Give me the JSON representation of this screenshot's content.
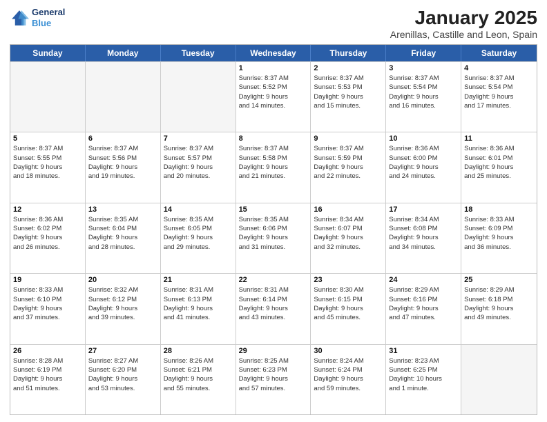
{
  "logo": {
    "line1": "General",
    "line2": "Blue"
  },
  "title": "January 2025",
  "subtitle": "Arenillas, Castille and Leon, Spain",
  "header_days": [
    "Sunday",
    "Monday",
    "Tuesday",
    "Wednesday",
    "Thursday",
    "Friday",
    "Saturday"
  ],
  "rows": [
    [
      {
        "day": "",
        "info": ""
      },
      {
        "day": "",
        "info": ""
      },
      {
        "day": "",
        "info": ""
      },
      {
        "day": "1",
        "info": "Sunrise: 8:37 AM\nSunset: 5:52 PM\nDaylight: 9 hours\nand 14 minutes."
      },
      {
        "day": "2",
        "info": "Sunrise: 8:37 AM\nSunset: 5:53 PM\nDaylight: 9 hours\nand 15 minutes."
      },
      {
        "day": "3",
        "info": "Sunrise: 8:37 AM\nSunset: 5:54 PM\nDaylight: 9 hours\nand 16 minutes."
      },
      {
        "day": "4",
        "info": "Sunrise: 8:37 AM\nSunset: 5:54 PM\nDaylight: 9 hours\nand 17 minutes."
      }
    ],
    [
      {
        "day": "5",
        "info": "Sunrise: 8:37 AM\nSunset: 5:55 PM\nDaylight: 9 hours\nand 18 minutes."
      },
      {
        "day": "6",
        "info": "Sunrise: 8:37 AM\nSunset: 5:56 PM\nDaylight: 9 hours\nand 19 minutes."
      },
      {
        "day": "7",
        "info": "Sunrise: 8:37 AM\nSunset: 5:57 PM\nDaylight: 9 hours\nand 20 minutes."
      },
      {
        "day": "8",
        "info": "Sunrise: 8:37 AM\nSunset: 5:58 PM\nDaylight: 9 hours\nand 21 minutes."
      },
      {
        "day": "9",
        "info": "Sunrise: 8:37 AM\nSunset: 5:59 PM\nDaylight: 9 hours\nand 22 minutes."
      },
      {
        "day": "10",
        "info": "Sunrise: 8:36 AM\nSunset: 6:00 PM\nDaylight: 9 hours\nand 24 minutes."
      },
      {
        "day": "11",
        "info": "Sunrise: 8:36 AM\nSunset: 6:01 PM\nDaylight: 9 hours\nand 25 minutes."
      }
    ],
    [
      {
        "day": "12",
        "info": "Sunrise: 8:36 AM\nSunset: 6:02 PM\nDaylight: 9 hours\nand 26 minutes."
      },
      {
        "day": "13",
        "info": "Sunrise: 8:35 AM\nSunset: 6:04 PM\nDaylight: 9 hours\nand 28 minutes."
      },
      {
        "day": "14",
        "info": "Sunrise: 8:35 AM\nSunset: 6:05 PM\nDaylight: 9 hours\nand 29 minutes."
      },
      {
        "day": "15",
        "info": "Sunrise: 8:35 AM\nSunset: 6:06 PM\nDaylight: 9 hours\nand 31 minutes."
      },
      {
        "day": "16",
        "info": "Sunrise: 8:34 AM\nSunset: 6:07 PM\nDaylight: 9 hours\nand 32 minutes."
      },
      {
        "day": "17",
        "info": "Sunrise: 8:34 AM\nSunset: 6:08 PM\nDaylight: 9 hours\nand 34 minutes."
      },
      {
        "day": "18",
        "info": "Sunrise: 8:33 AM\nSunset: 6:09 PM\nDaylight: 9 hours\nand 36 minutes."
      }
    ],
    [
      {
        "day": "19",
        "info": "Sunrise: 8:33 AM\nSunset: 6:10 PM\nDaylight: 9 hours\nand 37 minutes."
      },
      {
        "day": "20",
        "info": "Sunrise: 8:32 AM\nSunset: 6:12 PM\nDaylight: 9 hours\nand 39 minutes."
      },
      {
        "day": "21",
        "info": "Sunrise: 8:31 AM\nSunset: 6:13 PM\nDaylight: 9 hours\nand 41 minutes."
      },
      {
        "day": "22",
        "info": "Sunrise: 8:31 AM\nSunset: 6:14 PM\nDaylight: 9 hours\nand 43 minutes."
      },
      {
        "day": "23",
        "info": "Sunrise: 8:30 AM\nSunset: 6:15 PM\nDaylight: 9 hours\nand 45 minutes."
      },
      {
        "day": "24",
        "info": "Sunrise: 8:29 AM\nSunset: 6:16 PM\nDaylight: 9 hours\nand 47 minutes."
      },
      {
        "day": "25",
        "info": "Sunrise: 8:29 AM\nSunset: 6:18 PM\nDaylight: 9 hours\nand 49 minutes."
      }
    ],
    [
      {
        "day": "26",
        "info": "Sunrise: 8:28 AM\nSunset: 6:19 PM\nDaylight: 9 hours\nand 51 minutes."
      },
      {
        "day": "27",
        "info": "Sunrise: 8:27 AM\nSunset: 6:20 PM\nDaylight: 9 hours\nand 53 minutes."
      },
      {
        "day": "28",
        "info": "Sunrise: 8:26 AM\nSunset: 6:21 PM\nDaylight: 9 hours\nand 55 minutes."
      },
      {
        "day": "29",
        "info": "Sunrise: 8:25 AM\nSunset: 6:23 PM\nDaylight: 9 hours\nand 57 minutes."
      },
      {
        "day": "30",
        "info": "Sunrise: 8:24 AM\nSunset: 6:24 PM\nDaylight: 9 hours\nand 59 minutes."
      },
      {
        "day": "31",
        "info": "Sunrise: 8:23 AM\nSunset: 6:25 PM\nDaylight: 10 hours\nand 1 minute."
      },
      {
        "day": "",
        "info": ""
      }
    ]
  ]
}
